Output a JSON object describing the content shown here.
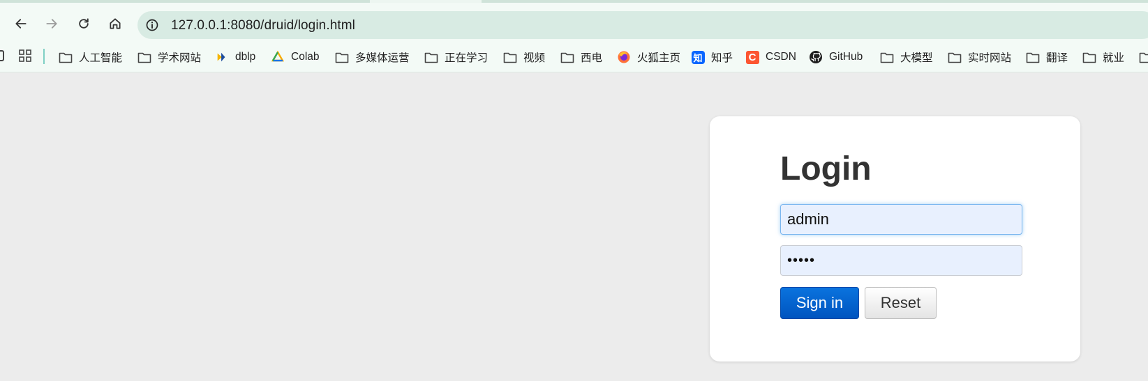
{
  "browser": {
    "url": "127.0.0.1:8080/druid/login.html",
    "icons": {
      "back": "arrow-left-icon",
      "forward": "arrow-right-icon",
      "reload": "reload-icon",
      "home": "home-icon",
      "site_info": "info-circle-icon",
      "apps": "apps-grid-icon"
    },
    "forward_enabled": false
  },
  "bookmarks": [
    {
      "label": "人工智能",
      "icon": "folder-icon"
    },
    {
      "label": "学术网站",
      "icon": "folder-icon"
    },
    {
      "label": "dblp",
      "icon": "dblp-logo-icon"
    },
    {
      "label": "Colab",
      "icon": "colab-logo-icon"
    },
    {
      "label": "多媒体运营",
      "icon": "folder-icon"
    },
    {
      "label": "正在学习",
      "icon": "folder-icon"
    },
    {
      "label": "视频",
      "icon": "folder-icon"
    },
    {
      "label": "西电",
      "icon": "folder-icon"
    },
    {
      "label": "火狐主页",
      "icon": "firefox-logo-icon"
    },
    {
      "label": "知乎",
      "icon": "zhihu-logo-icon",
      "badge": "知"
    },
    {
      "label": "CSDN",
      "icon": "csdn-logo-icon",
      "badge": "C"
    },
    {
      "label": "GitHub",
      "icon": "github-logo-icon"
    },
    {
      "label": "大模型",
      "icon": "folder-icon"
    },
    {
      "label": "实时网站",
      "icon": "folder-icon"
    },
    {
      "label": "翻译",
      "icon": "folder-icon"
    },
    {
      "label": "就业",
      "icon": "folder-icon"
    }
  ],
  "login": {
    "title": "Login",
    "username_value": "admin",
    "password_masked": "•••••",
    "signin_label": "Sign in",
    "reset_label": "Reset"
  },
  "colors": {
    "page_bg": "#ececec",
    "chrome_bg": "#f3faf6",
    "omnibox_bg": "#d8ebe3",
    "input_bg": "#e8f0fe",
    "primary_button": "#0060cc",
    "zhihu_blue": "#0a66ff",
    "csdn_red": "#fc5531"
  }
}
